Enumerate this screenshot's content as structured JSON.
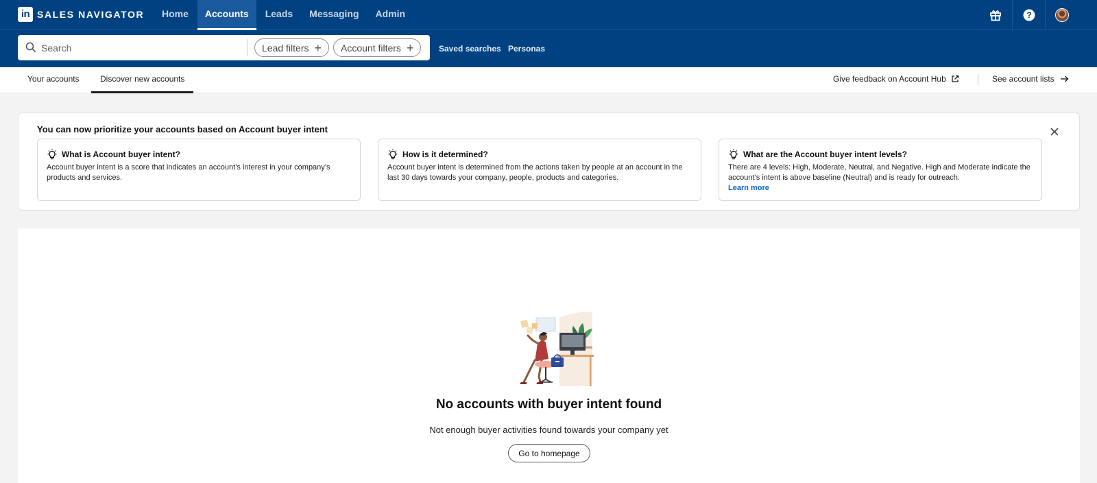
{
  "brand": {
    "logo_mark": "in",
    "product_name": "SALES NAVIGATOR"
  },
  "nav": {
    "items": [
      {
        "label": "Home"
      },
      {
        "label": "Accounts",
        "active": true
      },
      {
        "label": "Leads"
      },
      {
        "label": "Messaging"
      },
      {
        "label": "Admin"
      }
    ],
    "icons": [
      "gift-icon",
      "help-icon",
      "avatar"
    ]
  },
  "search": {
    "placeholder": "Search",
    "value": "",
    "lead_filters": "Lead filters",
    "account_filters": "Account filters",
    "saved_searches": "Saved searches",
    "personas": "Personas"
  },
  "tabs": {
    "your_accounts": "Your accounts",
    "discover": "Discover new accounts",
    "feedback": "Give feedback on Account Hub",
    "see_lists": "See account lists"
  },
  "banner": {
    "title": "You can now prioritize your accounts based on Account buyer intent",
    "cards": [
      {
        "heading": "What is Account buyer intent?",
        "body": "Account buyer intent is a score that indicates an account’s interest in your company’s products and services."
      },
      {
        "heading": "How is it determined?",
        "body": "Account buyer intent is determined from the actions taken by people at an account in the last 30 days towards your company, people, products and categories."
      },
      {
        "heading": "What are the Account buyer intent levels?",
        "body": "There are 4 levels: High, Moderate, Neutral, and Negative. High and Moderate indicate the account’s intent is above baseline (Neutral) and is ready for outreach.",
        "link": "Learn more"
      }
    ]
  },
  "empty_state": {
    "title": "No accounts with buyer intent found",
    "subtitle": "Not enough buyer activities found towards your company yet",
    "button": "Go to homepage"
  },
  "colors": {
    "nav_bg": "#004182",
    "link": "#0a66c2",
    "page_bg": "#f3f3f3"
  }
}
